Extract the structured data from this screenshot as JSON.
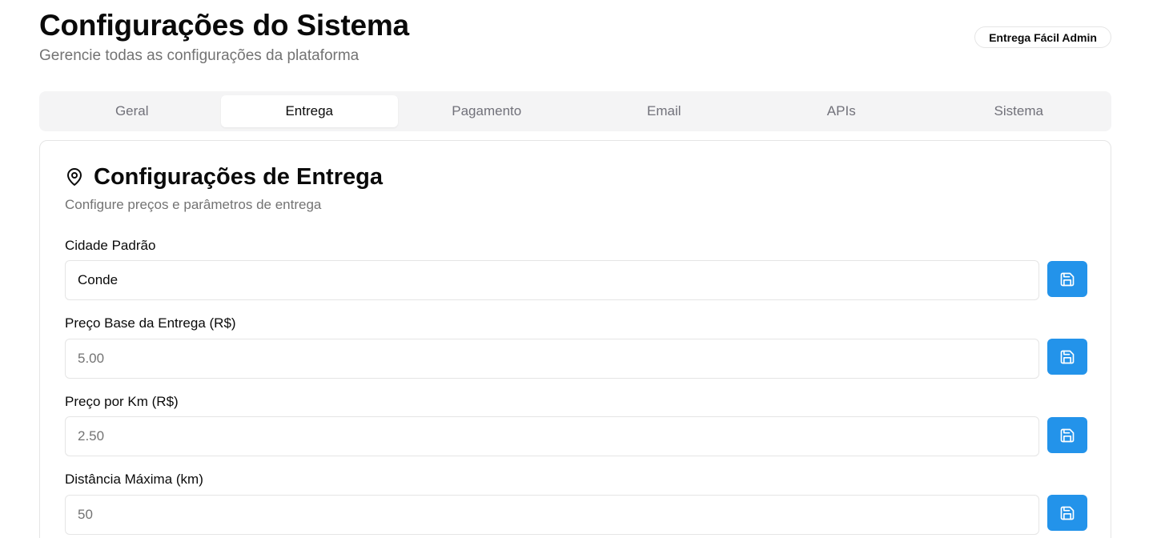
{
  "header": {
    "title": "Configurações do Sistema",
    "subtitle": "Gerencie todas as configurações da plataforma",
    "badge": "Entrega Fácil Admin"
  },
  "tabs": [
    {
      "label": "Geral",
      "active": false
    },
    {
      "label": "Entrega",
      "active": true
    },
    {
      "label": "Pagamento",
      "active": false
    },
    {
      "label": "Email",
      "active": false
    },
    {
      "label": "APIs",
      "active": false
    },
    {
      "label": "Sistema",
      "active": false
    }
  ],
  "card": {
    "icon": "map-pin-icon",
    "title": "Configurações de Entrega",
    "description": "Configure preços e parâmetros de entrega"
  },
  "fields": [
    {
      "label": "Cidade Padrão",
      "value": "Conde",
      "placeholder": ""
    },
    {
      "label": "Preço Base da Entrega (R$)",
      "value": "",
      "placeholder": "5.00"
    },
    {
      "label": "Preço por Km (R$)",
      "value": "",
      "placeholder": "2.50"
    },
    {
      "label": "Distância Máxima (km)",
      "value": "",
      "placeholder": "50"
    }
  ],
  "save_icon": "save-icon",
  "colors": {
    "accent": "#2393ea",
    "muted_text": "#737373",
    "tab_bg": "#f4f4f5",
    "border": "#e5e5e5"
  }
}
